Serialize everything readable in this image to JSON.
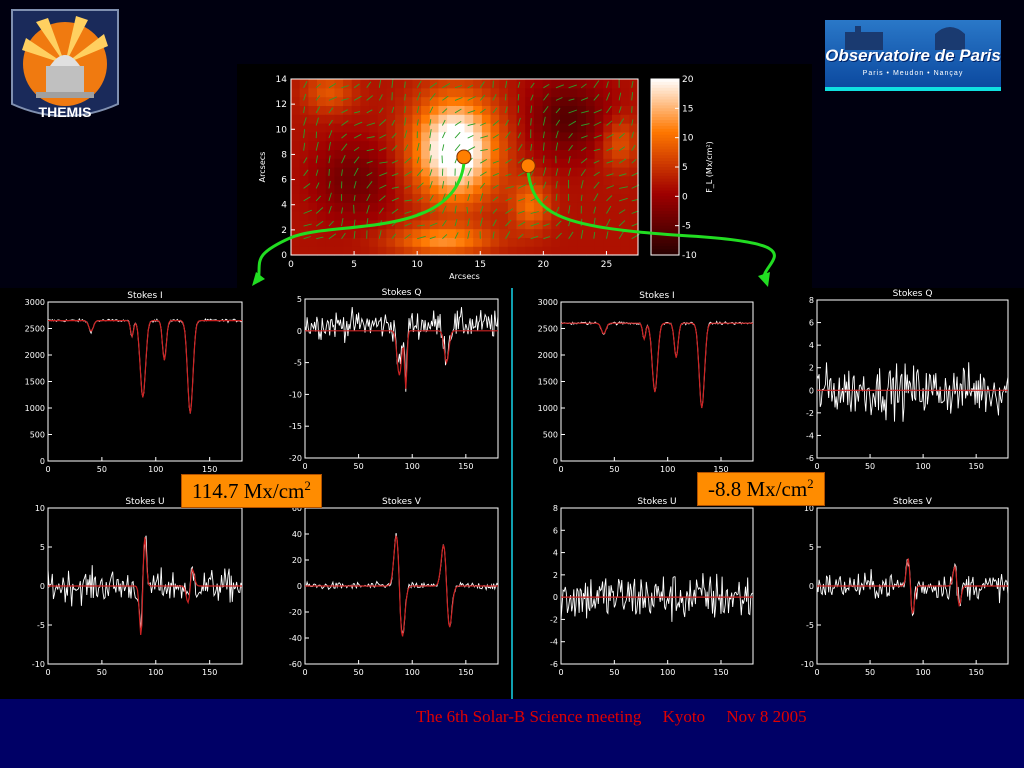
{
  "logos": {
    "themis_text": "THEMIS",
    "observatoire_text": "Observatoire de Paris",
    "observatoire_sub": "Paris • Meudon • Nançay"
  },
  "labels": {
    "left_value": "114.7 Mx/cm",
    "left_exp": "2",
    "right_value": "-8.8 Mx/cm",
    "right_exp": "2"
  },
  "footer": {
    "text": "The 6th Solar-B Science meeting     Kyoto     Nov 8 2005"
  },
  "colors": {
    "background": "#000010",
    "footer_bar": "#000066",
    "footer_text": "#e00000",
    "label_box": "#ff8c00",
    "arrows": "#22dd22",
    "fit_line": "#cc2222",
    "obs_line": "#ffffff",
    "marker": "#ff7f00"
  },
  "chart_data": [
    {
      "type": "heatmap",
      "id": "map",
      "title": "",
      "xlabel": "Arcsecs",
      "ylabel": "Arcsecs",
      "xlim": [
        0,
        27.5
      ],
      "ylim": [
        0,
        14
      ],
      "xticks": [
        0,
        5,
        10,
        15,
        20,
        25
      ],
      "yticks": [
        0,
        2,
        4,
        6,
        8,
        10,
        12,
        14
      ],
      "colorbar": {
        "label": "F_L (Mx/cm²)",
        "range": [
          -10,
          20
        ],
        "ticks": [
          -10,
          -5,
          0,
          5,
          10,
          15,
          20
        ]
      },
      "markers": [
        {
          "x": 13.7,
          "y": 7.8
        },
        {
          "x": 18.8,
          "y": 7.1
        }
      ]
    },
    {
      "type": "line",
      "id": "L_I",
      "title": "Stokes I",
      "xlim": [
        0,
        180
      ],
      "ylim": [
        0,
        3000
      ],
      "xticks": [
        0,
        50,
        100,
        150
      ],
      "yticks": [
        0,
        500,
        1000,
        1500,
        2000,
        2500,
        3000
      ],
      "continuum": 2650,
      "noise": 20,
      "obs_offset": 0,
      "lines": [
        {
          "c": 40,
          "w": 3,
          "d": 200
        },
        {
          "c": 88,
          "w": 3.5,
          "d": 1450
        },
        {
          "c": 108,
          "w": 2.5,
          "d": 750
        },
        {
          "c": 132,
          "w": 3.5,
          "d": 1750
        },
        {
          "c": 78,
          "w": 2,
          "d": 300
        }
      ],
      "series": [
        {
          "name": "observed"
        },
        {
          "name": "fit"
        }
      ]
    },
    {
      "type": "line",
      "id": "L_Q",
      "title": "Stokes Q",
      "xlim": [
        0,
        180
      ],
      "ylim": [
        -20,
        5
      ],
      "xticks": [
        0,
        50,
        100,
        150
      ],
      "yticks": [
        -20,
        -15,
        -10,
        -5,
        0,
        5
      ],
      "continuum": 0,
      "noise": 1.6,
      "obs_offset": 1,
      "lines": [
        {
          "c": 88,
          "w": 3,
          "d": 7
        },
        {
          "c": 94,
          "w": 1.5,
          "d": 9
        },
        {
          "c": 132,
          "w": 3,
          "d": 5
        }
      ],
      "series": [
        {
          "name": "observed"
        },
        {
          "name": "fit"
        }
      ]
    },
    {
      "type": "line",
      "id": "L_U",
      "title": "Stokes U",
      "xlim": [
        0,
        180
      ],
      "ylim": [
        -10,
        10
      ],
      "xticks": [
        0,
        50,
        100,
        150
      ],
      "yticks": [
        -10,
        -5,
        0,
        5,
        10
      ],
      "continuum": 0,
      "noise": 1.5,
      "obs_offset": 0,
      "antisym": [
        {
          "c": 88,
          "w": 2.5,
          "a": 9
        },
        {
          "c": 132,
          "w": 3,
          "a": 3
        }
      ],
      "series": [
        {
          "name": "observed"
        },
        {
          "name": "fit"
        }
      ]
    },
    {
      "type": "line",
      "id": "L_V",
      "title": "Stokes V",
      "xlim": [
        0,
        180
      ],
      "ylim": [
        -60,
        60
      ],
      "xticks": [
        0,
        50,
        100,
        150
      ],
      "yticks": [
        -60,
        -40,
        -20,
        0,
        20,
        40,
        60
      ],
      "continuum": 0,
      "noise": 2,
      "obs_offset": 0,
      "antisym": [
        {
          "c": 88,
          "w": 4,
          "a": -55
        },
        {
          "c": 132,
          "w": 4,
          "a": -45
        }
      ],
      "series": [
        {
          "name": "observed"
        },
        {
          "name": "fit"
        }
      ]
    },
    {
      "type": "line",
      "id": "R_I",
      "title": "Stokes I",
      "xlim": [
        0,
        180
      ],
      "ylim": [
        0,
        3000
      ],
      "xticks": [
        0,
        50,
        100,
        150
      ],
      "yticks": [
        0,
        500,
        1000,
        1500,
        2000,
        2500,
        3000
      ],
      "continuum": 2600,
      "noise": 20,
      "obs_offset": 0,
      "lines": [
        {
          "c": 40,
          "w": 3,
          "d": 200
        },
        {
          "c": 88,
          "w": 3.5,
          "d": 1300
        },
        {
          "c": 108,
          "w": 2.5,
          "d": 650
        },
        {
          "c": 132,
          "w": 3.5,
          "d": 1600
        },
        {
          "c": 78,
          "w": 2,
          "d": 300
        }
      ],
      "series": [
        {
          "name": "observed"
        },
        {
          "name": "fit"
        }
      ]
    },
    {
      "type": "line",
      "id": "R_Q",
      "title": "Stokes Q",
      "xlim": [
        0,
        180
      ],
      "ylim": [
        -6,
        8
      ],
      "xticks": [
        0,
        50,
        100,
        150
      ],
      "yticks": [
        -6,
        -4,
        -2,
        0,
        2,
        4,
        6,
        8
      ],
      "continuum": 0,
      "noise": 1.6,
      "obs_offset": 0,
      "series": [
        {
          "name": "observed"
        },
        {
          "name": "fit"
        }
      ]
    },
    {
      "type": "line",
      "id": "R_U",
      "title": "Stokes U",
      "xlim": [
        0,
        180
      ],
      "ylim": [
        -6,
        8
      ],
      "xticks": [
        0,
        50,
        100,
        150
      ],
      "yticks": [
        -6,
        -4,
        -2,
        0,
        2,
        4,
        6,
        8
      ],
      "continuum": 0,
      "noise": 1.6,
      "obs_offset": 0,
      "series": [
        {
          "name": "observed"
        },
        {
          "name": "fit"
        }
      ]
    },
    {
      "type": "line",
      "id": "R_V",
      "title": "Stokes V",
      "xlim": [
        0,
        180
      ],
      "ylim": [
        -10,
        10
      ],
      "xticks": [
        0,
        50,
        100,
        150
      ],
      "yticks": [
        -10,
        -5,
        0,
        5,
        10
      ],
      "continuum": 0,
      "noise": 1.2,
      "obs_offset": 0,
      "antisym": [
        {
          "c": 88,
          "w": 3,
          "a": -5
        },
        {
          "c": 132,
          "w": 3,
          "a": -3.5
        }
      ],
      "series": [
        {
          "name": "observed"
        },
        {
          "name": "fit"
        }
      ]
    }
  ]
}
